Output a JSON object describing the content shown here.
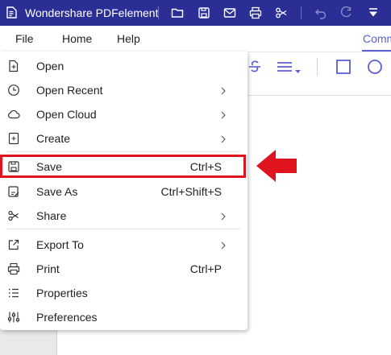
{
  "window": {
    "title": "Wondershare PDFelement"
  },
  "menubar": {
    "file": "File",
    "home": "Home",
    "help": "Help",
    "comment_tab": "Comm"
  },
  "file_menu": {
    "items": [
      {
        "label": "Open",
        "icon": "open-file-icon",
        "shortcut": "",
        "submenu": false
      },
      {
        "label": "Open Recent",
        "icon": "clock-icon",
        "shortcut": "",
        "submenu": true
      },
      {
        "label": "Open Cloud",
        "icon": "cloud-icon",
        "shortcut": "",
        "submenu": true
      },
      {
        "label": "Create",
        "icon": "create-icon",
        "shortcut": "",
        "submenu": true
      },
      {
        "label": "Save",
        "icon": "save-icon",
        "shortcut": "Ctrl+S",
        "submenu": false,
        "highlighted": true
      },
      {
        "label": "Save As",
        "icon": "save-as-icon",
        "shortcut": "Ctrl+Shift+S",
        "submenu": false
      },
      {
        "label": "Share",
        "icon": "share-icon",
        "shortcut": "",
        "submenu": true
      },
      {
        "label": "Export To",
        "icon": "export-icon",
        "shortcut": "",
        "submenu": true
      },
      {
        "label": "Print",
        "icon": "print-icon",
        "shortcut": "Ctrl+P",
        "submenu": false
      },
      {
        "label": "Properties",
        "icon": "properties-icon",
        "shortcut": "",
        "submenu": false
      },
      {
        "label": "Preferences",
        "icon": "preferences-icon",
        "shortcut": "",
        "submenu": false
      }
    ]
  },
  "colors": {
    "titlebar": "#2b2f95",
    "accent": "#5b5fd6",
    "highlight": "#e0141e"
  }
}
